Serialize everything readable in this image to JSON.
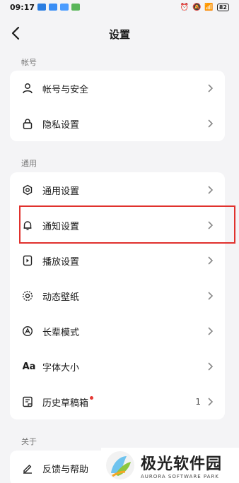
{
  "status": {
    "time": "09:17",
    "battery": "82"
  },
  "header": {
    "title": "设置"
  },
  "sections": [
    {
      "label": "帐号",
      "items": [
        {
          "label": "帐号与安全",
          "icon": "person-icon"
        },
        {
          "label": "隐私设置",
          "icon": "lock-icon"
        }
      ]
    },
    {
      "label": "通用",
      "items": [
        {
          "label": "通用设置",
          "icon": "gear-icon"
        },
        {
          "label": "通知设置",
          "icon": "bell-icon"
        },
        {
          "label": "播放设置",
          "icon": "play-settings-icon"
        },
        {
          "label": "动态壁纸",
          "icon": "wallpaper-icon"
        },
        {
          "label": "长辈模式",
          "icon": "elder-mode-icon"
        },
        {
          "label": "字体大小",
          "icon": "font-size-icon"
        },
        {
          "label": "历史草稿箱",
          "icon": "drafts-icon",
          "count": "1"
        }
      ]
    },
    {
      "label": "关于",
      "items": [
        {
          "label": "反馈与帮助",
          "icon": "feedback-icon"
        }
      ]
    }
  ],
  "watermark": {
    "cn": "极光软件园",
    "en": "AURORA SOFTWARE PARK"
  },
  "colors": {
    "highlight": "#e0312d",
    "badge": "#e53935"
  }
}
